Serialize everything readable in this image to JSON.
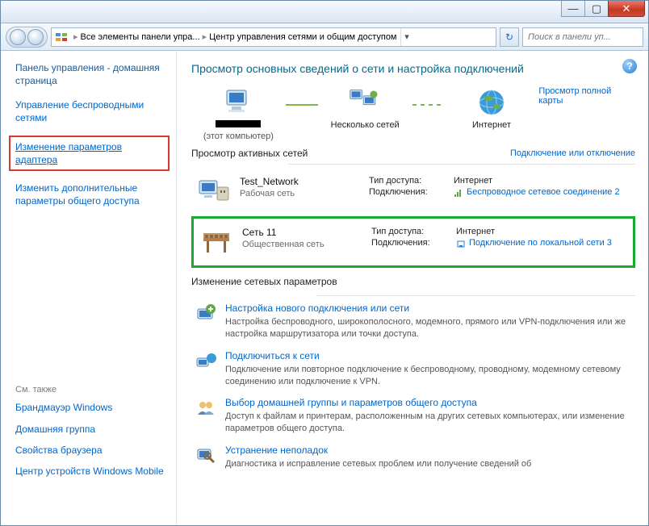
{
  "window": {
    "min": "—",
    "max": "▢",
    "close": "✕"
  },
  "address": {
    "crumb1": "Все элементы панели упра...",
    "crumb2": "Центр управления сетями и общим доступом",
    "search_placeholder": "Поиск в панели уп..."
  },
  "sidebar": {
    "heading": "Панель управления - домашняя страница",
    "link_wireless": "Управление беспроводными сетями",
    "link_adapter": "Изменение параметров адаптера",
    "link_advanced": "Изменить дополнительные параметры общего доступа",
    "see_also": "См. также",
    "sa_firewall": "Брандмауэр Windows",
    "sa_homegroup": "Домашняя группа",
    "sa_browser": "Свойства браузера",
    "sa_mobile": "Центр устройств Windows Mobile"
  },
  "main": {
    "title": "Просмотр основных сведений о сети и настройка подключений",
    "full_map": "Просмотр полной карты",
    "map": {
      "this_pc_sub": "(этот компьютер)",
      "multiple": "Несколько сетей",
      "internet": "Интернет"
    },
    "active_section": "Просмотр активных сетей",
    "connect_disconnect": "Подключение или отключение",
    "net1": {
      "name": "Test_Network",
      "type": "Рабочая сеть",
      "access_label": "Тип доступа:",
      "access_val": "Интернет",
      "conn_label": "Подключения:",
      "conn_val": "Беспроводное сетевое соединение 2"
    },
    "net2": {
      "name": "Сеть  11",
      "type": "Общественная сеть",
      "access_label": "Тип доступа:",
      "access_val": "Интернет",
      "conn_label": "Подключения:",
      "conn_val": "Подключение по локальной сети 3"
    },
    "change_section": "Изменение сетевых параметров",
    "tasks": {
      "t1_title": "Настройка нового подключения или сети",
      "t1_desc": "Настройка беспроводного, широкополосного, модемного, прямого или VPN-подключения или же настройка маршрутизатора или точки доступа.",
      "t2_title": "Подключиться к сети",
      "t2_desc": "Подключение или повторное подключение к беспроводному, проводному, модемному сетевому соединению или подключение к VPN.",
      "t3_title": "Выбор домашней группы и параметров общего доступа",
      "t3_desc": "Доступ к файлам и принтерам, расположенным на других сетевых компьютерах, или изменение параметров общего доступа.",
      "t4_title": "Устранение неполадок",
      "t4_desc": "Диагностика и исправление сетевых проблем или получение сведений об"
    }
  }
}
